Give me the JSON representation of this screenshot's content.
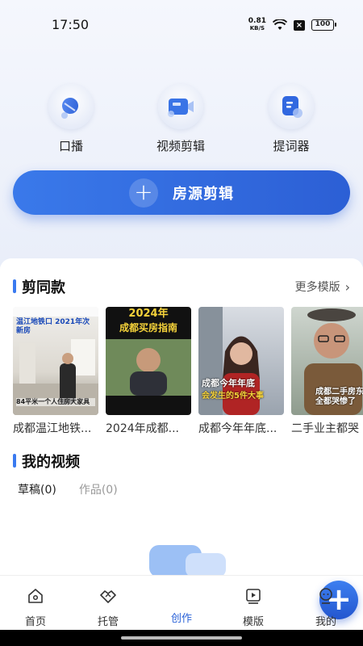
{
  "status_bar": {
    "time": "17:50",
    "net_speed_value": "0.81",
    "net_speed_unit": "KB/S",
    "battery": "100"
  },
  "tools": [
    {
      "label": "口播",
      "icon": "microphone-icon"
    },
    {
      "label": "视频剪辑",
      "icon": "video-camera-icon"
    },
    {
      "label": "提词器",
      "icon": "teleprompter-icon"
    }
  ],
  "main_action": {
    "label": "房源剪辑",
    "icon": "plus-icon"
  },
  "template_section": {
    "title": "剪同款",
    "more_label": "更多模版",
    "items": [
      {
        "caption": "成都温江地铁...",
        "overlay_top": "温江地铁口 2021年次新房",
        "overlay_bottom": "84平米一个人住房大家具"
      },
      {
        "caption": "2024年成都...",
        "overlay_top": "2024年",
        "overlay_bottom": "成都买房指南"
      },
      {
        "caption": "成都今年年底...",
        "overlay_top": "成都今年年底",
        "overlay_bottom": "会发生的5件大事"
      },
      {
        "caption": "二手业主都哭",
        "overlay_top": "成都二手房东",
        "overlay_bottom": "全都哭惨了"
      }
    ]
  },
  "my_videos": {
    "title": "我的视频",
    "tabs": [
      {
        "label": "草稿(0)",
        "active": true
      },
      {
        "label": "作品(0)",
        "active": false
      }
    ]
  },
  "bottom_nav": [
    {
      "label": "首页",
      "icon": "home-icon"
    },
    {
      "label": "托管",
      "icon": "handshake-icon"
    },
    {
      "label": "创作",
      "icon": "plus-icon"
    },
    {
      "label": "模版",
      "icon": "template-icon"
    },
    {
      "label": "我的",
      "icon": "profile-icon"
    }
  ],
  "colors": {
    "accent": "#2c5fd5",
    "nav_active": "#2a62d8"
  }
}
